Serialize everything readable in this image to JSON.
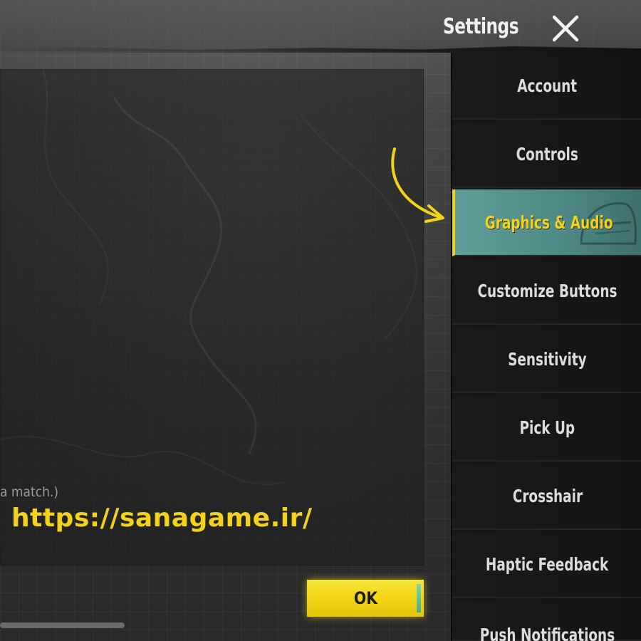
{
  "header": {
    "title": "Settings",
    "close_icon": "close-icon"
  },
  "sidebar": {
    "items": [
      {
        "label": "Account",
        "active": false
      },
      {
        "label": "Controls",
        "active": false
      },
      {
        "label": "Graphics & Audio",
        "active": true
      },
      {
        "label": "Customize Buttons",
        "active": false
      },
      {
        "label": "Sensitivity",
        "active": false
      },
      {
        "label": "Pick Up",
        "active": false
      },
      {
        "label": "Crosshair",
        "active": false
      },
      {
        "label": "Haptic Feedback",
        "active": false
      },
      {
        "label": "Push Notifications",
        "active": false
      }
    ]
  },
  "content": {
    "match_note": "a match.)"
  },
  "watermark": {
    "url": "https://sanagame.ir/"
  },
  "footer": {
    "ok_label": "OK"
  },
  "colors": {
    "accent": "#f5d21a",
    "active_tab": "#5f9e99",
    "sidebar_bg": "#151515"
  },
  "annotation": {
    "arrow_icon": "curved-arrow-icon"
  }
}
